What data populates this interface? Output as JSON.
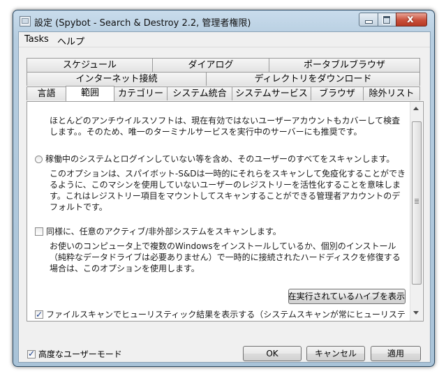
{
  "window": {
    "title": "設定 (Spybot - Search & Destroy 2.2, 管理者権限)",
    "close_glyph": "x"
  },
  "menu": [
    "Tasks",
    "ヘルプ"
  ],
  "tabs": {
    "row1": [
      "スケジュール",
      "ダイアログ",
      "ポータブルブラウザ"
    ],
    "row2": [
      "インターネット接続",
      "ディレクトリをダウンロード"
    ],
    "row3": [
      "言語",
      "範囲",
      "カテゴリー",
      "システム統合",
      "システムサービス",
      "ブラウザ",
      "除外リスト"
    ],
    "active": "範囲"
  },
  "content": {
    "intro": "ほとんどのアンチウイルスソフトは、現在有効ではないユーザーアカウントもカバーして検査します。。そのため、唯一のターミナルサービスを実行中のサーバーにも推奨です。",
    "option1_label": "稼働中のシステムとログインしていない等を含め、そのユーザーのすべてをスキャンします。",
    "option1_selected": false,
    "option1_desc": "このオプションは、スパイボット-S&Dは一時的にそれらをスキャンして免疫化することができるように、このマシンを使用していないユーザーのレジストリーを活性化することを意味します。これはレジストリー項目をマウントしてスキャンすることができる管理者アカウントのデフォルトです。",
    "option2_label": "同様に、任意のアクティブ/非外部システムをスキャンします。",
    "option2_checked": false,
    "option2_desc": "お使いのコンピュータ上で複数のWindowsをインストールしているか、個別のインストール（純粋なデータドライブは必要ありません）で一時的に接続されたハードディスクを修復する場合は、このオプションを使用します。",
    "hive_button": "現在実行されているハイブを表示",
    "heuristic_label": "ファイルスキャンでヒューリスティック結果を表示する（システムスキャンが常にヒューリステ",
    "heuristic_checked": true
  },
  "footer": {
    "advanced_mode_label": "高度なユーザーモード",
    "advanced_mode_checked": true,
    "ok": "OK",
    "cancel": "キャンセル",
    "apply": "適用"
  },
  "colors": {
    "frame": "#b6cde0",
    "panel": "#ffffff",
    "close_button": "#c9503b"
  }
}
